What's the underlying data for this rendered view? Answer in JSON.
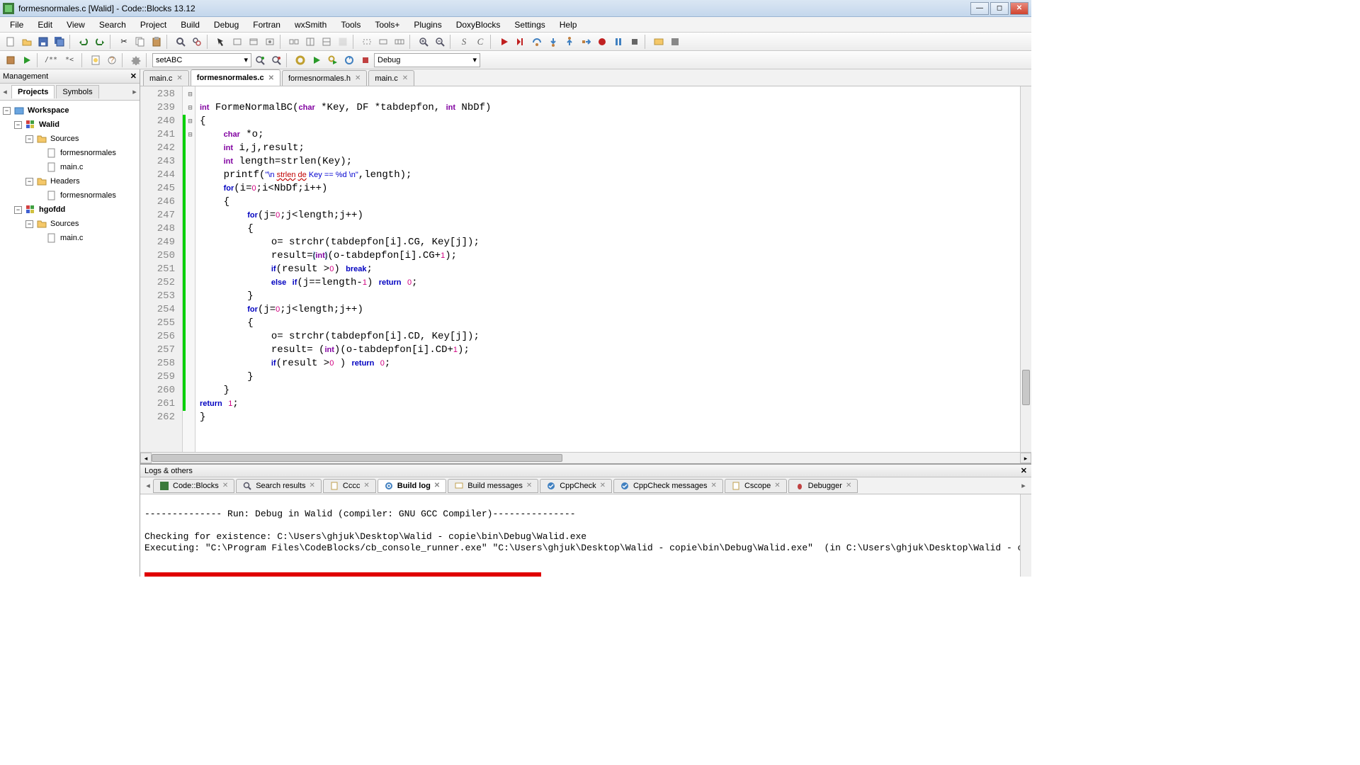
{
  "window": {
    "title": "formesnormales.c [Walid] - Code::Blocks 13.12"
  },
  "menus": [
    "File",
    "Edit",
    "View",
    "Search",
    "Project",
    "Build",
    "Debug",
    "Fortran",
    "wxSmith",
    "Tools",
    "Tools+",
    "Plugins",
    "DoxyBlocks",
    "Settings",
    "Help"
  ],
  "toolbar2": {
    "combo1": "setABC",
    "combo2": "Debug"
  },
  "management": {
    "title": "Management",
    "tabs": [
      "Projects",
      "Symbols"
    ],
    "workspace": "Workspace",
    "projects": [
      {
        "name": "Walid",
        "folders": [
          {
            "name": "Sources",
            "files": [
              "formesnormales",
              "main.c"
            ]
          },
          {
            "name": "Headers",
            "files": [
              "formesnormales"
            ]
          }
        ]
      },
      {
        "name": "hgofdd",
        "folders": [
          {
            "name": "Sources",
            "files": [
              "main.c"
            ]
          }
        ]
      }
    ]
  },
  "filetabs": [
    {
      "label": "main.c",
      "active": false
    },
    {
      "label": "formesnormales.c",
      "active": true
    },
    {
      "label": "formesnormales.h",
      "active": false
    },
    {
      "label": "main.c",
      "active": false
    }
  ],
  "code": {
    "first_line": 238,
    "lines": [
      {
        "n": 238,
        "fold": "",
        "mod": false,
        "html": ""
      },
      {
        "n": 239,
        "fold": "",
        "mod": false,
        "html": "<span class='ty'>int</span> FormeNormalBC(<span class='ty'>char</span> *Key, DF *tabdepfon, <span class='ty'>int</span> NbDf)"
      },
      {
        "n": 240,
        "fold": "⊟",
        "mod": true,
        "html": "{"
      },
      {
        "n": 241,
        "fold": "",
        "mod": true,
        "html": "    <span class='ty'>char</span> *o;"
      },
      {
        "n": 242,
        "fold": "",
        "mod": true,
        "html": "    <span class='ty'>int</span> i,j,result;"
      },
      {
        "n": 243,
        "fold": "",
        "mod": true,
        "html": "    <span class='ty'>int</span> length=strlen(Key);"
      },
      {
        "n": 244,
        "fold": "",
        "mod": true,
        "html": "    printf(<span class='st'>\"\\n <span class='err'>strlen</span> <span class='err'>de</span> Key == %d \\n\"</span>,length);"
      },
      {
        "n": 245,
        "fold": "",
        "mod": true,
        "html": "    <span class='kw'>for</span>(i=<span class='nm'>0</span>;i&lt;NbDf;i++)"
      },
      {
        "n": 246,
        "fold": "⊟",
        "mod": true,
        "html": "    {"
      },
      {
        "n": 247,
        "fold": "",
        "mod": true,
        "html": "        <span class='kw'>for</span>(j=<span class='nm'>0</span>;j&lt;length;j++)"
      },
      {
        "n": 248,
        "fold": "⊟",
        "mod": true,
        "html": "        {"
      },
      {
        "n": 249,
        "fold": "",
        "mod": true,
        "html": "            o= strchr(tabdepfon[i].CG, Key[j]);"
      },
      {
        "n": 250,
        "fold": "",
        "mod": true,
        "html": "            result=<span class='hl'>(</span><span class='ty'>int</span><span class='hl'>)</span>(o-tabdepfon[i].CG+<span class='nm'>1</span>);"
      },
      {
        "n": 251,
        "fold": "",
        "mod": true,
        "html": "            <span class='kw'>if</span>(result &gt;<span class='nm'>0</span>) <span class='kw'>break</span>;"
      },
      {
        "n": 252,
        "fold": "",
        "mod": true,
        "html": "            <span class='kw'>else</span> <span class='kw'>if</span>(j==length-<span class='nm'>1</span>) <span class='kw'>return</span> <span class='nm'>0</span>;"
      },
      {
        "n": 253,
        "fold": "",
        "mod": true,
        "html": "        }"
      },
      {
        "n": 254,
        "fold": "",
        "mod": true,
        "html": "        <span class='kw'>for</span>(j=<span class='nm'>0</span>;j&lt;length;j++)"
      },
      {
        "n": 255,
        "fold": "⊟",
        "mod": true,
        "html": "        {"
      },
      {
        "n": 256,
        "fold": "",
        "mod": true,
        "html": "            o= strchr(tabdepfon[i].CD, Key[j]);"
      },
      {
        "n": 257,
        "fold": "",
        "mod": true,
        "html": "            result= (<span class='ty'>int</span>)(o-tabdepfon[i].CD+<span class='nm'>1</span>);"
      },
      {
        "n": 258,
        "fold": "",
        "mod": true,
        "html": "            <span class='kw'>if</span>(result &gt;<span class='nm'>0</span> ) <span class='kw'>return</span> <span class='nm'>0</span>;"
      },
      {
        "n": 259,
        "fold": "",
        "mod": true,
        "html": "        }"
      },
      {
        "n": 260,
        "fold": "",
        "mod": true,
        "html": "    }"
      },
      {
        "n": 261,
        "fold": "",
        "mod": true,
        "html": "<span class='kw'>return</span> <span class='nm'>1</span>;"
      },
      {
        "n": 262,
        "fold": "",
        "mod": false,
        "html": "}"
      }
    ]
  },
  "logs": {
    "title": "Logs & others",
    "tabs": [
      {
        "label": "Code::Blocks",
        "icon": "cb"
      },
      {
        "label": "Search results",
        "icon": "search"
      },
      {
        "label": "Cccc",
        "icon": "doc"
      },
      {
        "label": "Build log",
        "icon": "gear",
        "active": true
      },
      {
        "label": "Build messages",
        "icon": "msg"
      },
      {
        "label": "CppCheck",
        "icon": "check"
      },
      {
        "label": "CppCheck messages",
        "icon": "check"
      },
      {
        "label": "Cscope",
        "icon": "doc"
      },
      {
        "label": "Debugger",
        "icon": "bug"
      }
    ],
    "lines": [
      "",
      "-------------- Run: Debug in Walid (compiler: GNU GCC Compiler)---------------",
      "",
      "Checking for existence: C:\\Users\\ghjuk\\Desktop\\Walid - copie\\bin\\Debug\\Walid.exe",
      "Executing: \"C:\\Program Files\\CodeBlocks/cb_console_runner.exe\" \"C:\\Users\\ghjuk\\Desktop\\Walid - copie\\bin\\Debug\\Walid.exe\"  (in C:\\Users\\ghjuk\\Desktop\\Walid - copie\\.)"
    ]
  }
}
